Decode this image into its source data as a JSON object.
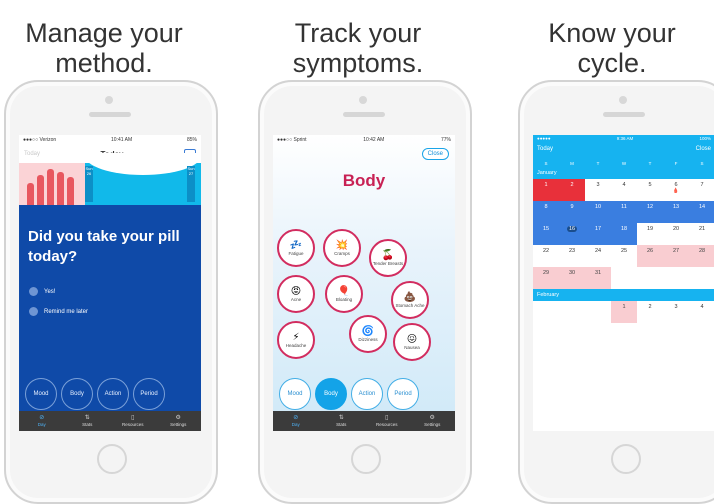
{
  "captions": [
    {
      "line1": "Manage your",
      "line2": "method."
    },
    {
      "line1": "Track your",
      "line2": "symptoms."
    },
    {
      "line1": "Know your",
      "line2": "cycle."
    }
  ],
  "phone1": {
    "status": {
      "carrier": "●●●○○ Verizon",
      "time": "10:41 AM",
      "battery": "85%"
    },
    "nav": {
      "left": "Today",
      "title": "Today"
    },
    "chart_marks": [
      {
        "label": "Sun 26"
      },
      {
        "label": "Sun 27"
      }
    ],
    "question": "Did you take your pill today?",
    "options": [
      "Yes!",
      "Remind me later"
    ],
    "bottom_circles": [
      "Mood",
      "Body",
      "Action",
      "Period"
    ],
    "tabs": [
      {
        "icon": "⊘",
        "label": "Day",
        "active": true
      },
      {
        "icon": "⇅",
        "label": "Stats"
      },
      {
        "icon": "▯",
        "label": "Resources"
      },
      {
        "icon": "⚙",
        "label": "Settings"
      }
    ],
    "colors": {
      "main": "#0f4aa8",
      "accent": "#11b9ea",
      "period": "#e8575f"
    }
  },
  "phone2": {
    "status": {
      "carrier": "●●●○○ Sprint",
      "time": "10:42 AM",
      "battery": "77%"
    },
    "close_label": "Close",
    "title": "Body",
    "symptoms": [
      {
        "icon": "💤",
        "label": "Fatigue"
      },
      {
        "icon": "💥",
        "label": "Cramps"
      },
      {
        "icon": "🍒",
        "label": "Tender Breasts"
      },
      {
        "icon": "😡",
        "label": "Acne"
      },
      {
        "icon": "🎈",
        "label": "Bloating"
      },
      {
        "icon": "💩",
        "label": "Stomach Ache"
      },
      {
        "icon": "⚡",
        "label": "Headache"
      },
      {
        "icon": "🌀",
        "label": "Dizziness"
      },
      {
        "icon": "😖",
        "label": "Nausea"
      }
    ],
    "bottom_circles": [
      "Mood",
      "Body",
      "Action",
      "Period"
    ],
    "active_circle": "Body",
    "tabs": [
      {
        "icon": "⊘",
        "label": "Day",
        "active": true
      },
      {
        "icon": "⇅",
        "label": "Stats"
      },
      {
        "icon": "▯",
        "label": "Resources"
      },
      {
        "icon": "⚙",
        "label": "Settings"
      }
    ],
    "colors": {
      "title": "#c82154",
      "accent": "#13a3e8"
    }
  },
  "phone3": {
    "status": {
      "carrier": "●●●●●",
      "time": "9:36 AM",
      "battery": "100%"
    },
    "header": {
      "today": "Today",
      "close": "Close"
    },
    "dows": [
      "S",
      "M",
      "T",
      "W",
      "T",
      "F",
      "S"
    ],
    "months": [
      {
        "name": "January",
        "weeks": [
          [
            {
              "d": "1",
              "s": "red"
            },
            {
              "d": "2",
              "s": "red"
            },
            {
              "d": "3"
            },
            {
              "d": "4"
            },
            {
              "d": "5"
            },
            {
              "d": "6",
              "drop": true
            },
            {
              "d": "7"
            }
          ],
          [
            {
              "d": "8",
              "s": "blue"
            },
            {
              "d": "9",
              "s": "blue"
            },
            {
              "d": "10",
              "s": "blue"
            },
            {
              "d": "11",
              "s": "blue"
            },
            {
              "d": "12",
              "s": "blue"
            },
            {
              "d": "13",
              "s": "blue"
            },
            {
              "d": "14",
              "s": "blue"
            }
          ],
          [
            {
              "d": "15",
              "s": "blue"
            },
            {
              "d": "16",
              "s": "blue",
              "today": true
            },
            {
              "d": "17",
              "s": "blue"
            },
            {
              "d": "18",
              "s": "blue"
            },
            {
              "d": "19"
            },
            {
              "d": "20"
            },
            {
              "d": "21"
            }
          ],
          [
            {
              "d": "22"
            },
            {
              "d": "23"
            },
            {
              "d": "24"
            },
            {
              "d": "25"
            },
            {
              "d": "26",
              "s": "pink"
            },
            {
              "d": "27",
              "s": "pink"
            },
            {
              "d": "28",
              "s": "pink"
            }
          ],
          [
            {
              "d": "29",
              "s": "pink"
            },
            {
              "d": "30",
              "s": "pink"
            },
            {
              "d": "31",
              "s": "pink"
            },
            {
              "d": ""
            },
            {
              "d": ""
            },
            {
              "d": ""
            },
            {
              "d": ""
            }
          ]
        ]
      },
      {
        "name": "February",
        "weeks": [
          [
            {
              "d": ""
            },
            {
              "d": ""
            },
            {
              "d": ""
            },
            {
              "d": "1",
              "s": "pink"
            },
            {
              "d": "2"
            },
            {
              "d": "3"
            },
            {
              "d": "4"
            }
          ]
        ]
      }
    ],
    "colors": {
      "header": "#16b3f0",
      "period": "#e8303a",
      "fertile": "#3a7ee0",
      "predicted": "#f9cdd1"
    }
  }
}
